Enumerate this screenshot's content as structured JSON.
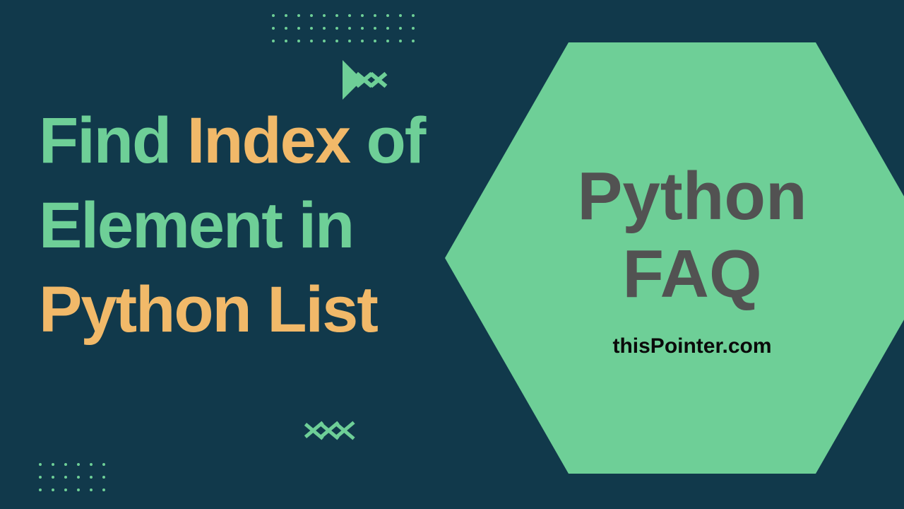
{
  "headline": {
    "words": [
      {
        "text": "Find",
        "color": "green"
      },
      {
        "text": "Index",
        "color": "amber"
      },
      {
        "text": "of",
        "color": "green"
      },
      {
        "text": "Element",
        "color": "green"
      },
      {
        "text": "in",
        "color": "green"
      },
      {
        "text": "Python",
        "color": "amber"
      },
      {
        "text": "List",
        "color": "amber"
      }
    ]
  },
  "hexagon": {
    "title_line1": "Python",
    "title_line2": "FAQ",
    "subtitle": "thisPointer.com"
  },
  "colors": {
    "bg": "#11394b",
    "green": "#6ecf97",
    "amber": "#f1b969",
    "grey": "#525252"
  }
}
